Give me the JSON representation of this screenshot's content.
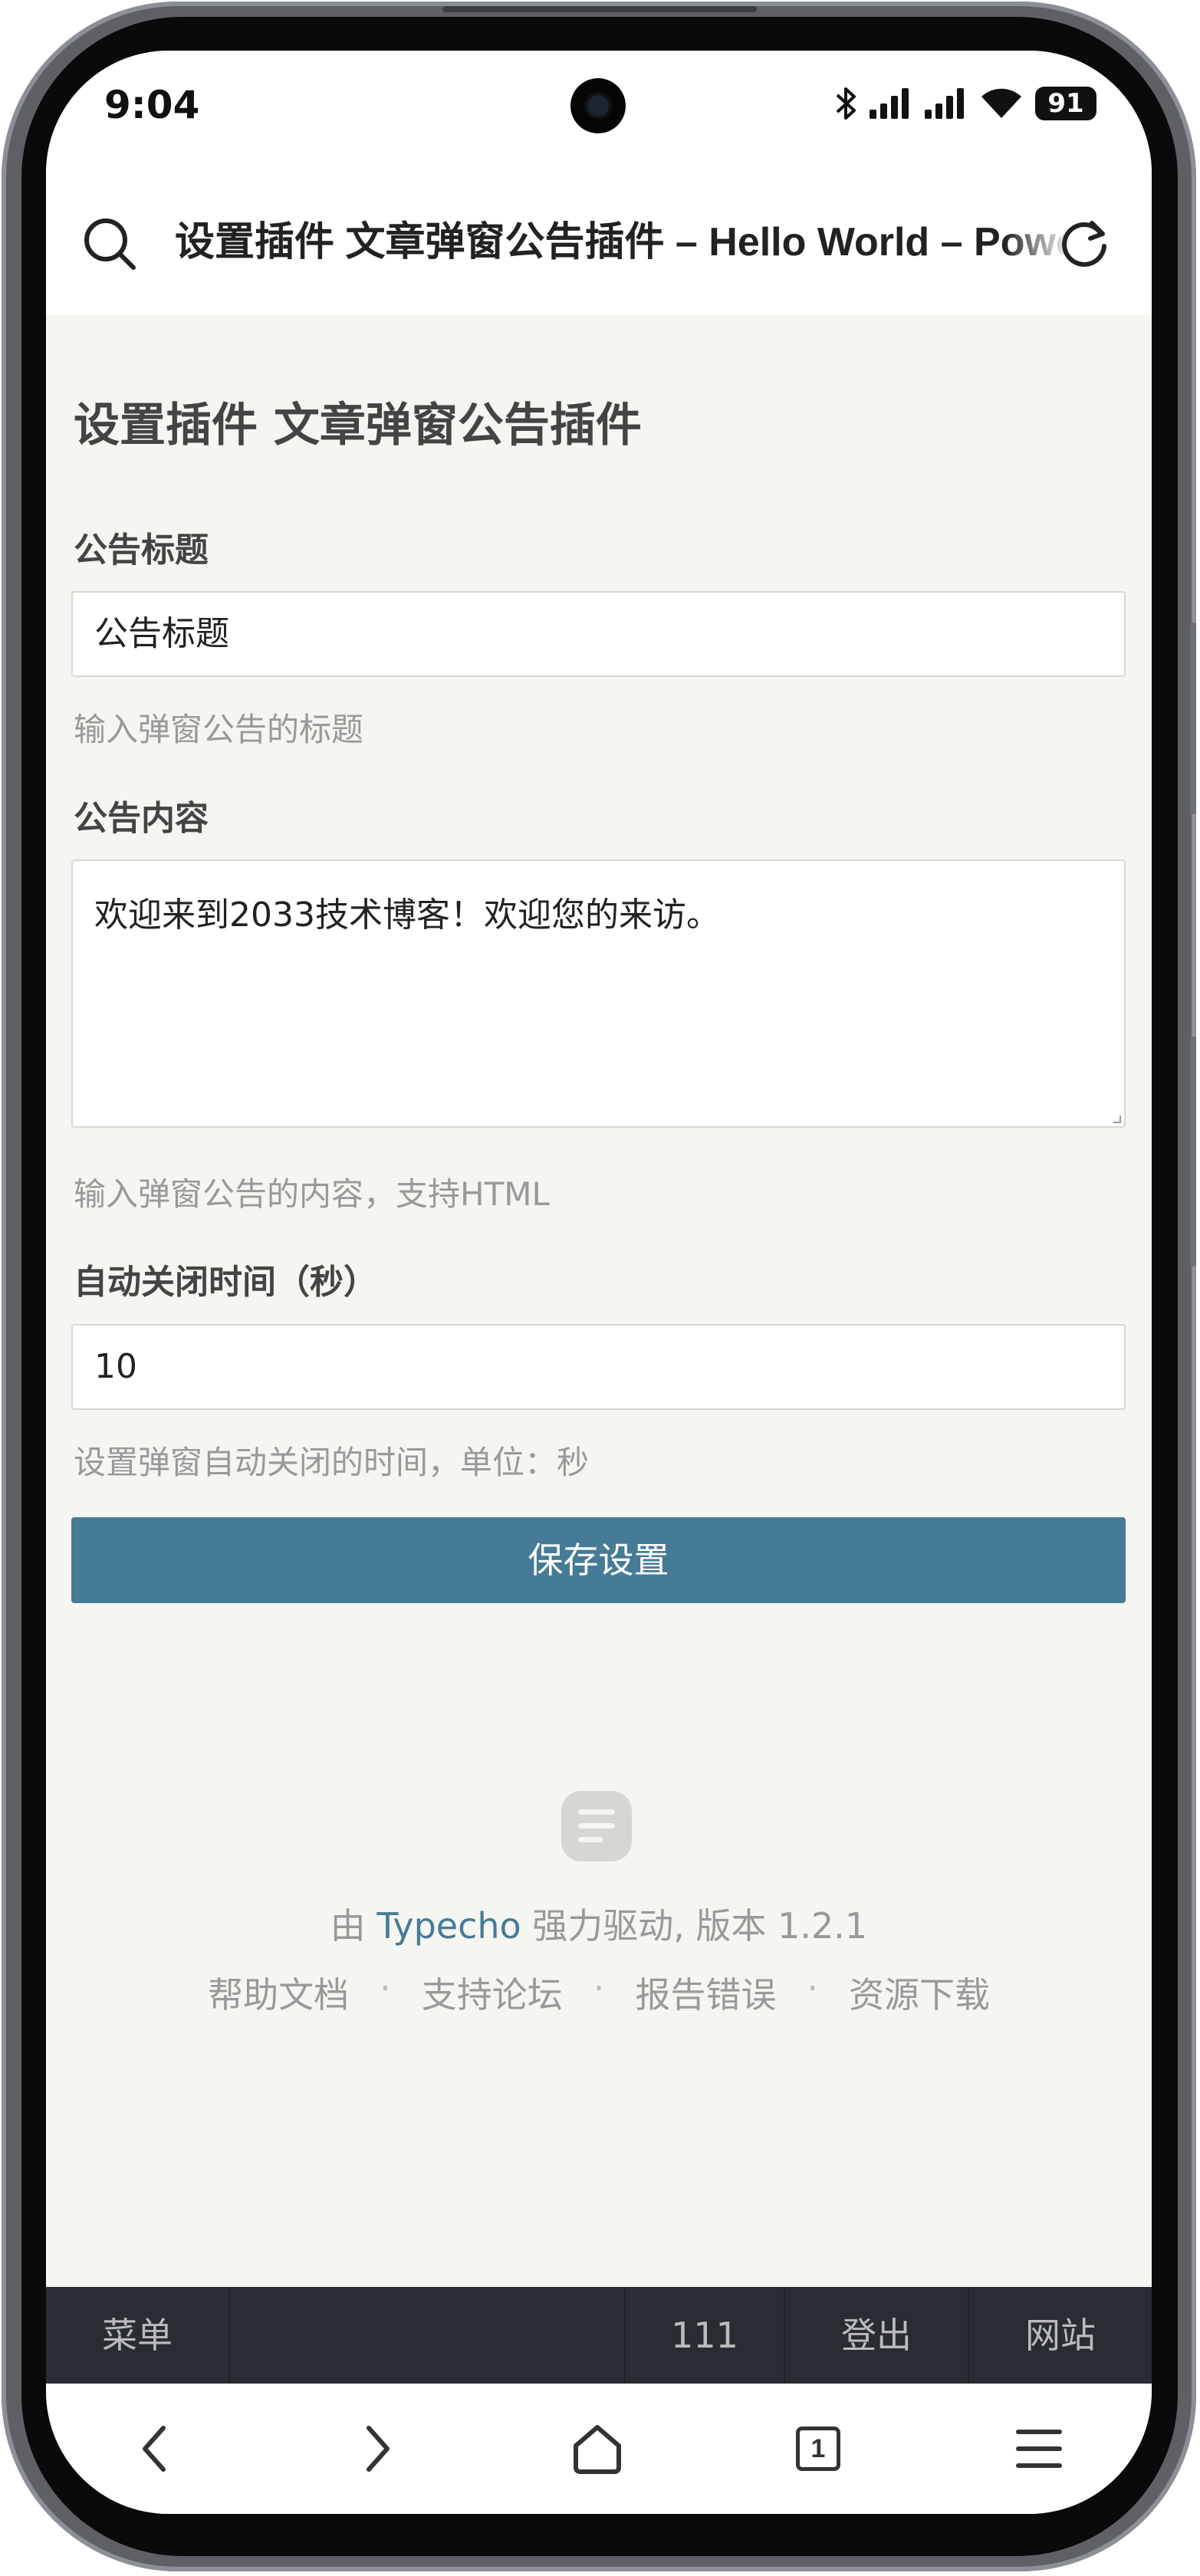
{
  "status_bar": {
    "time": "9:04",
    "battery": "91",
    "icons": [
      "bluetooth-icon",
      "signal-icon",
      "signal-icon",
      "wifi-icon",
      "battery-icon"
    ]
  },
  "url_bar": {
    "title": "设置插件 文章弹窗公告插件 – Hello World – Powered by Typecho",
    "icons": [
      "search-icon",
      "reload-icon"
    ]
  },
  "page": {
    "title": "设置插件 文章弹窗公告插件",
    "fields": [
      {
        "label": "公告标题",
        "value": "公告标题",
        "hint": "输入弹窗公告的标题"
      },
      {
        "label": "公告内容",
        "value": "欢迎来到2033技术博客！欢迎您的来访。",
        "hint": "输入弹窗公告的内容，支持HTML"
      },
      {
        "label": "自动关闭时间（秒）",
        "value": "10",
        "hint": "设置弹窗自动关闭的时间，单位：秒"
      }
    ],
    "save_label": "保存设置"
  },
  "footer": {
    "powered_prefix": "由",
    "powered_link": "Typecho",
    "powered_suffix": "强力驱动, 版本 1.2.1",
    "links": [
      "帮助文档",
      "支持论坛",
      "报告错误",
      "资源下载"
    ],
    "separator": "·"
  },
  "admin_bar": {
    "menu": "菜单",
    "user": "111",
    "logout": "登出",
    "site": "网站"
  },
  "browser_nav": {
    "tab_count": "1",
    "icons": [
      "back-icon",
      "forward-icon",
      "home-icon",
      "tabs-icon",
      "menu-icon"
    ]
  },
  "colors": {
    "accent": "#467b96",
    "page_bg": "#f5f5f1",
    "admin_bar_bg": "#292d33"
  }
}
